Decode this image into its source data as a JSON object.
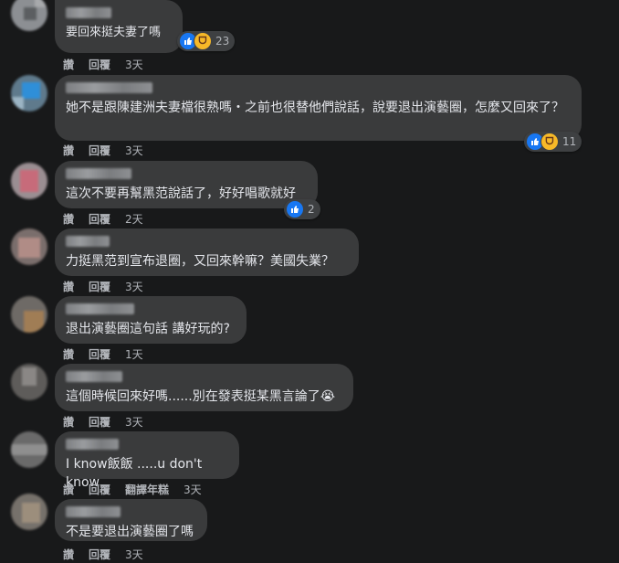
{
  "actions": {
    "like": "讚",
    "reply": "回覆",
    "translate": "翻譯年糕"
  },
  "comments": [
    {
      "text": "要回來挺夫妻了嗎",
      "time": "3天",
      "reactions": "23"
    },
    {
      "text": "她不是跟陳建洲夫妻檔很熟嗎・之前也很替他們說話，說要退出演藝圈，怎麼又回來了？",
      "time": "3天",
      "reactions": "11"
    },
    {
      "text": "這次不要再幫黑范說話了，好好唱歌就好",
      "time": "2天",
      "reactions": "2"
    },
    {
      "text": "力挺黑范到宣布退圈，又回來幹嘛？美國失業？",
      "time": "3天"
    },
    {
      "text": "退出演藝圈這句話 講好玩的?",
      "time": "1天"
    },
    {
      "text": "這個時候回來好嗎......別在發表挺某黑言論了",
      "time": "3天",
      "emoji": "😭"
    },
    {
      "text": "I know飯飯 .....u don't know",
      "time": "3天"
    },
    {
      "text": "不是要退出演藝圈了嗎",
      "time": "3天"
    }
  ]
}
